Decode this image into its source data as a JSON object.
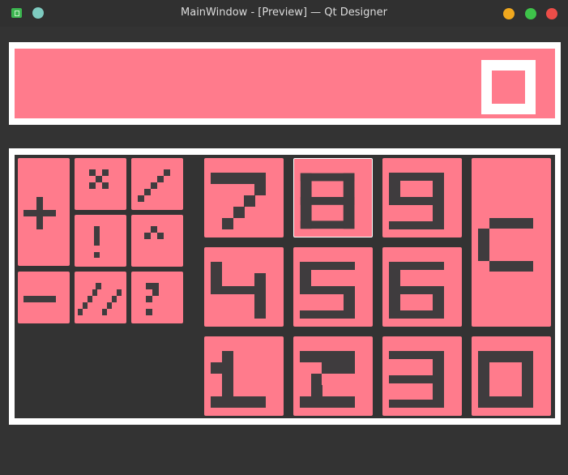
{
  "window": {
    "title": "MainWindow - [Preview] — Qt Designer"
  },
  "icons": {
    "app": "qt-designer-app-icon",
    "pin": "pin-icon",
    "minimize": "minimize-icon",
    "maximize": "maximize-icon",
    "close": "close-icon"
  },
  "colors": {
    "key_background": "#ff7b8c",
    "glyph": "#3f3c3e",
    "window_background": "#333333",
    "frame_border": "#ffffff",
    "minimize_button": "#f0a81e",
    "maximize_button": "#3ec34a",
    "close_button": "#ec4d48"
  },
  "display": {
    "value": "0"
  },
  "keys": {
    "operators": [
      "+",
      "×",
      "/",
      "!",
      "^",
      "−",
      "//",
      "?"
    ],
    "digits": [
      "7",
      "8",
      "9",
      "4",
      "5",
      "6",
      "1",
      "2",
      "3",
      "0"
    ],
    "clear": "C"
  }
}
